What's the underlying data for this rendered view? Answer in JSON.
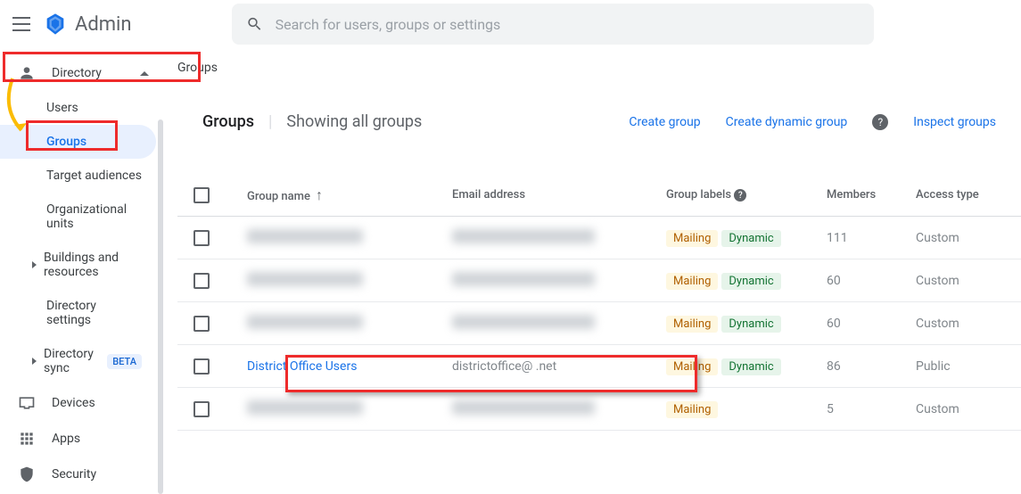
{
  "header": {
    "product": "Admin",
    "search_placeholder": "Search for users, groups or settings"
  },
  "sidebar": {
    "directory": "Directory",
    "items": [
      "Users",
      "Groups",
      "Target audiences",
      "Organizational units",
      "Buildings and resources",
      "Directory settings",
      "Directory sync"
    ],
    "beta": "BETA",
    "devices": "Devices",
    "apps": "Apps",
    "security": "Security"
  },
  "breadcrumb": "Groups",
  "panel": {
    "title": "Groups",
    "subtitle": "Showing all groups",
    "actions": {
      "create": "Create group",
      "create_dynamic": "Create dynamic group",
      "inspect": "Inspect groups"
    }
  },
  "columns": {
    "name": "Group name",
    "email": "Email address",
    "labels": "Group labels",
    "members": "Members",
    "access": "Access type"
  },
  "labels": {
    "mailing": "Mailing",
    "dynamic": "Dynamic"
  },
  "rows": [
    {
      "name": "",
      "email": "",
      "labels": [
        "mailing",
        "dynamic"
      ],
      "members": "111",
      "access": "Custom",
      "redacted": true
    },
    {
      "name": "",
      "email": "",
      "labels": [
        "mailing",
        "dynamic"
      ],
      "members": "60",
      "access": "Custom",
      "redacted": true
    },
    {
      "name": "",
      "email": "",
      "labels": [
        "mailing",
        "dynamic"
      ],
      "members": "60",
      "access": "Custom",
      "redacted": true
    },
    {
      "name": "District Office Users",
      "email": "districtoffice@​            .net",
      "labels": [
        "mailing",
        "dynamic"
      ],
      "members": "86",
      "access": "Public",
      "redacted": false,
      "highlight": true
    },
    {
      "name": "",
      "email": "",
      "labels": [
        "mailing"
      ],
      "members": "5",
      "access": "Custom",
      "redacted": true
    }
  ]
}
